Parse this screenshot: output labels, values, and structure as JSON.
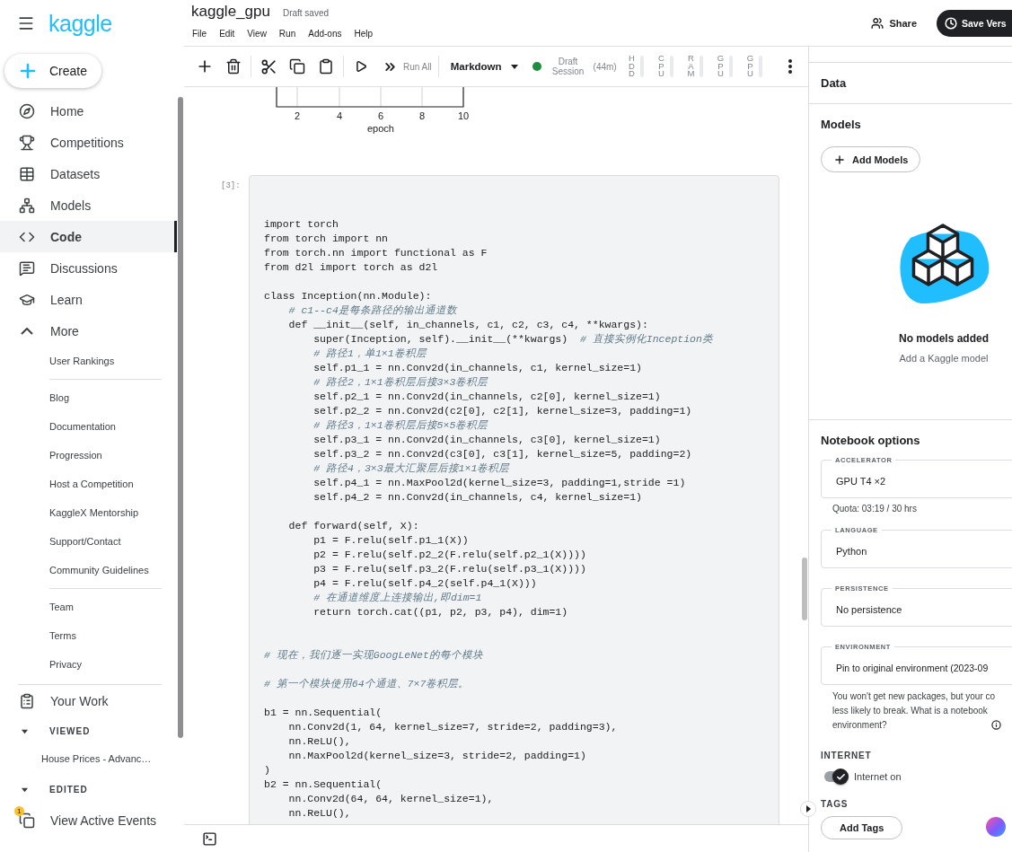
{
  "sidebar": {
    "logo": "kaggle",
    "create": "Create",
    "nav": [
      {
        "label": "Home",
        "selected": false
      },
      {
        "label": "Competitions",
        "selected": false
      },
      {
        "label": "Datasets",
        "selected": false
      },
      {
        "label": "Models",
        "selected": false
      },
      {
        "label": "Code",
        "selected": true
      },
      {
        "label": "Discussions",
        "selected": false
      },
      {
        "label": "Learn",
        "selected": false
      }
    ],
    "more": {
      "label": "More",
      "expanded": true,
      "groups": [
        [
          "User Rankings"
        ],
        [
          "Blog",
          "Documentation",
          "Progression",
          "Host a Competition",
          "KaggleX Mentorship",
          "Support/Contact",
          "Community Guidelines"
        ],
        [
          "Team",
          "Terms",
          "Privacy"
        ]
      ]
    },
    "your_work": "Your Work",
    "viewed": {
      "label": "VIEWED",
      "expanded": true,
      "items": [
        "House Prices - Advanc…"
      ]
    },
    "edited": {
      "label": "EDITED",
      "expanded": true
    },
    "events": {
      "label": "View Active Events",
      "badge": "1"
    }
  },
  "header": {
    "title": "kaggle_gpu",
    "status": "Draft saved",
    "menu": [
      "File",
      "Edit",
      "View",
      "Run",
      "Add-ons",
      "Help"
    ],
    "share": "Share",
    "save": "Save Vers"
  },
  "toolbar": {
    "run_all": "Run All",
    "cell_type": "Markdown",
    "session": {
      "label": "Draft Session",
      "time": "(44m)",
      "active": true
    },
    "meters": [
      {
        "label": "HDD"
      },
      {
        "label": "CPU"
      },
      {
        "label": "RAM"
      },
      {
        "label": "GPU"
      },
      {
        "label": "GPU"
      }
    ]
  },
  "plot": {
    "xticks": [
      "2",
      "4",
      "6",
      "8",
      "10"
    ],
    "xlabel": "epoch"
  },
  "cell": {
    "prompt": "[3]:",
    "lines": [
      {
        "kind": "code",
        "text": "import torch"
      },
      {
        "kind": "code",
        "text": "from torch import nn"
      },
      {
        "kind": "code",
        "text": "from torch.nn import functional as F"
      },
      {
        "kind": "code",
        "text": "from d2l import torch as d2l"
      },
      {
        "kind": "blank"
      },
      {
        "kind": "code",
        "text": "class Inception(nn.Module):"
      },
      {
        "kind": "comment",
        "text": "    # c1--c4是每条路径的输出通道数"
      },
      {
        "kind": "code",
        "text": "    def __init__(self, in_channels, c1, c2, c3, c4, **kwargs):"
      },
      {
        "kind": "code",
        "text": "        super(Inception, self).__init__(**kwargs)  ",
        "comment": "# 直接实例化Inception类"
      },
      {
        "kind": "comment",
        "text": "        # 路径1，单1×1卷积层"
      },
      {
        "kind": "code",
        "text": "        self.p1_1 = nn.Conv2d(in_channels, c1, kernel_size=1)"
      },
      {
        "kind": "comment",
        "text": "        # 路径2，1×1卷积层后接3×3卷积层"
      },
      {
        "kind": "code",
        "text": "        self.p2_1 = nn.Conv2d(in_channels, c2[0], kernel_size=1)"
      },
      {
        "kind": "code",
        "text": "        self.p2_2 = nn.Conv2d(c2[0], c2[1], kernel_size=3, padding=1)"
      },
      {
        "kind": "comment",
        "text": "        # 路径3，1×1卷积层后接5×5卷积层"
      },
      {
        "kind": "code",
        "text": "        self.p3_1 = nn.Conv2d(in_channels, c3[0], kernel_size=1)"
      },
      {
        "kind": "code",
        "text": "        self.p3_2 = nn.Conv2d(c3[0], c3[1], kernel_size=5, padding=2)"
      },
      {
        "kind": "comment",
        "text": "        # 路径4，3×3最大汇聚层后接1×1卷积层"
      },
      {
        "kind": "code",
        "text": "        self.p4_1 = nn.MaxPool2d(kernel_size=3, padding=1,stride =1)"
      },
      {
        "kind": "code",
        "text": "        self.p4_2 = nn.Conv2d(in_channels, c4, kernel_size=1)"
      },
      {
        "kind": "blank"
      },
      {
        "kind": "code",
        "text": "    def forward(self, X):"
      },
      {
        "kind": "code",
        "text": "        p1 = F.relu(self.p1_1(X))"
      },
      {
        "kind": "code",
        "text": "        p2 = F.relu(self.p2_2(F.relu(self.p2_1(X))))"
      },
      {
        "kind": "code",
        "text": "        p3 = F.relu(self.p3_2(F.relu(self.p3_1(X))))"
      },
      {
        "kind": "code",
        "text": "        p4 = F.relu(self.p4_2(self.p4_1(X)))"
      },
      {
        "kind": "comment",
        "text": "        # 在通道维度上连接输出,即dim=1"
      },
      {
        "kind": "code",
        "text": "        return torch.cat((p1, p2, p3, p4), dim=1)"
      },
      {
        "kind": "blank"
      },
      {
        "kind": "blank"
      },
      {
        "kind": "comment",
        "text": "# 现在，我们逐一实现GoogLeNet的每个模块"
      },
      {
        "kind": "blank"
      },
      {
        "kind": "comment",
        "text": "# 第一个模块使用64个通道、7×7卷积层。"
      },
      {
        "kind": "blank"
      },
      {
        "kind": "code",
        "text": "b1 = nn.Sequential("
      },
      {
        "kind": "code",
        "text": "    nn.Conv2d(1, 64, kernel_size=7, stride=2, padding=3),"
      },
      {
        "kind": "code",
        "text": "    nn.ReLU(),"
      },
      {
        "kind": "code",
        "text": "    nn.MaxPool2d(kernel_size=3, stride=2, padding=1)"
      },
      {
        "kind": "code",
        "text": ")"
      },
      {
        "kind": "code",
        "text": "b2 = nn.Sequential("
      },
      {
        "kind": "code",
        "text": "    nn.Conv2d(64, 64, kernel_size=1),"
      },
      {
        "kind": "code",
        "text": "    nn.ReLU(),"
      }
    ]
  },
  "panel": {
    "data": {
      "title": "Data"
    },
    "models": {
      "title": "Models",
      "add": "Add Models",
      "empty_title": "No models added",
      "empty_hint": "Add a Kaggle model"
    },
    "options": {
      "title": "Notebook options",
      "fields": [
        {
          "label": "ACCELERATOR",
          "value": "GPU T4 ×2",
          "note": "Quota: 03:19 / 30 hrs"
        },
        {
          "label": "LANGUAGE",
          "value": "Python"
        },
        {
          "label": "PERSISTENCE",
          "value": "No persistence"
        },
        {
          "label": "ENVIRONMENT",
          "value": "Pin to original environment (2023-09",
          "help": [
            "You won't get new packages, but your co",
            "less likely to break. What is a notebook",
            "environment?"
          ]
        }
      ],
      "internet": {
        "heading": "INTERNET",
        "label": "Internet on",
        "on": true
      },
      "tags": {
        "heading": "TAGS",
        "button": "Add Tags"
      }
    }
  }
}
